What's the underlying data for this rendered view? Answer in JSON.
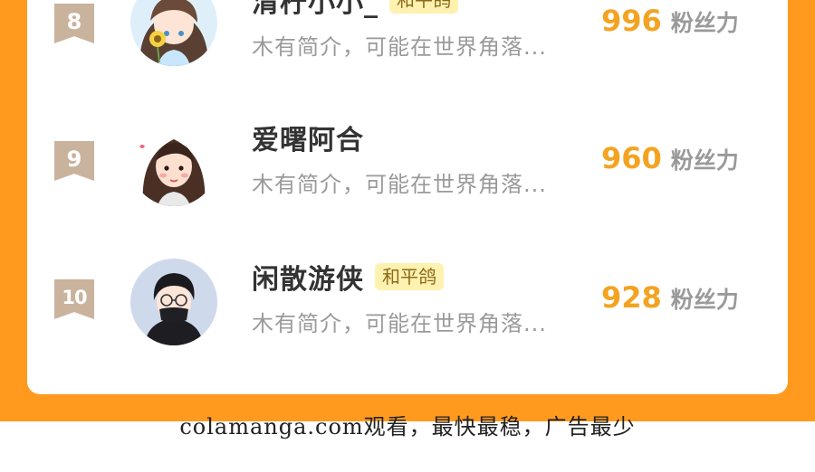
{
  "list": {
    "entries": [
      {
        "rank": "8",
        "name": "清柠小小_",
        "tag": "和平鸽",
        "bio": "木有简介，可能在世界角落...",
        "score": "996",
        "unit": "粉丝力",
        "avatar": "anime-girl-sunflower-avatar"
      },
      {
        "rank": "9",
        "name": "爱曙阿合",
        "tag": "",
        "bio": "木有简介，可能在世界角落...",
        "score": "960",
        "unit": "粉丝力",
        "avatar": "cartoon-girl-long-hair-avatar"
      },
      {
        "rank": "10",
        "name": "闲散游侠",
        "tag": "和平鸽",
        "bio": "木有简介，可能在世界角落...",
        "score": "928",
        "unit": "粉丝力",
        "avatar": "cartoon-boy-glasses-mask-avatar"
      }
    ]
  },
  "caption": "colamanga.com观看，最快最稳，广告最少",
  "colors": {
    "frame": "#ff9a1f",
    "score": "#f4a321",
    "rank_badge": "#c9b39c",
    "tag_bg": "#fff1b0"
  }
}
